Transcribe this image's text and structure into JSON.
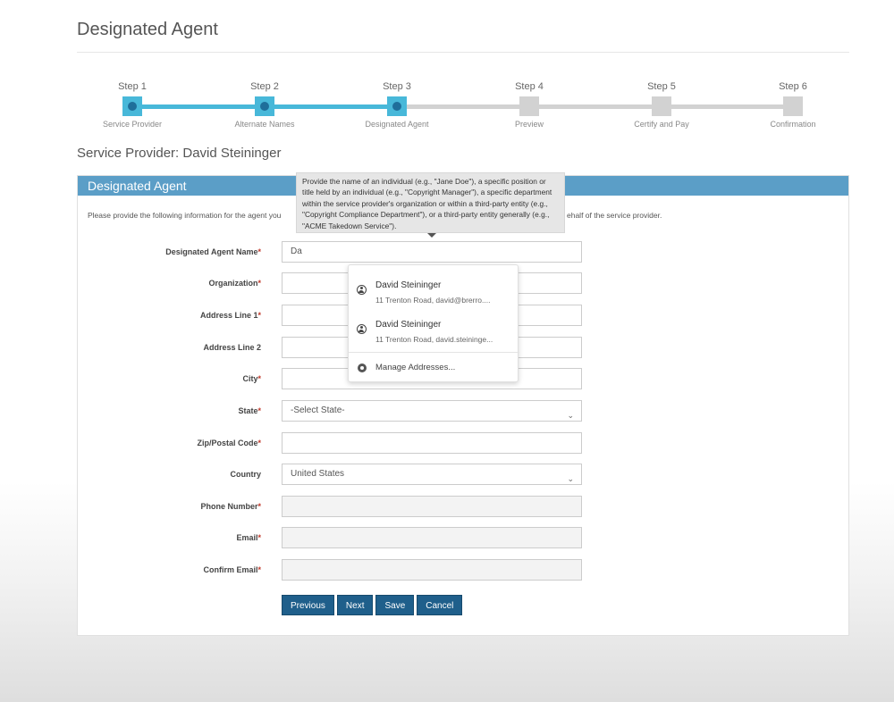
{
  "page": {
    "title": "Designated Agent"
  },
  "stepper": {
    "steps": [
      {
        "top": "Step 1",
        "bottom": "Service Provider",
        "done": true
      },
      {
        "top": "Step 2",
        "bottom": "Alternate Names",
        "done": true
      },
      {
        "top": "Step 3",
        "bottom": "Designated Agent",
        "done": true
      },
      {
        "top": "Step 4",
        "bottom": "Preview",
        "done": false
      },
      {
        "top": "Step 5",
        "bottom": "Certify and Pay",
        "done": false
      },
      {
        "top": "Step 6",
        "bottom": "Confirmation",
        "done": false
      }
    ],
    "active_color": "#48b8d9",
    "inactive_color": "#d2d2d2"
  },
  "service_provider_heading": "Service Provider: David Steininger",
  "panel": {
    "header": "Designated Agent",
    "desc_start": "Please provide the following information for the agent you",
    "desc_end": "ehalf of the service provider."
  },
  "tooltip": {
    "text": "Provide the name of an individual (e.g., \"Jane Doe\"), a specific position or title held by an individual (e.g., \"Copyright Manager\"), a specific department within the service provider's organization or within a third-party entity (e.g., \"Copyright Compliance Department\"), or a third-party entity generally (e.g., \"ACME Takedown Service\")."
  },
  "form": {
    "agent_name": {
      "label": "Designated Agent Name",
      "value": "Da"
    },
    "organization": {
      "label": "Organization",
      "value": ""
    },
    "address1": {
      "label": "Address Line 1",
      "value": ""
    },
    "address2": {
      "label": "Address Line 2",
      "value": ""
    },
    "city": {
      "label": "City",
      "value": ""
    },
    "state": {
      "label": "State",
      "value": "-Select State-"
    },
    "zip": {
      "label": "Zip/Postal Code",
      "value": ""
    },
    "country": {
      "label": "Country",
      "value": "United States"
    },
    "phone": {
      "label": "Phone Number",
      "value": ""
    },
    "email": {
      "label": "Email",
      "value": ""
    },
    "confirm_email": {
      "label": "Confirm Email",
      "value": ""
    },
    "required_mark": "*",
    "chevron": "⌄"
  },
  "buttons": {
    "previous": "Previous",
    "next": "Next",
    "save": "Save",
    "cancel": "Cancel"
  },
  "autofill": {
    "items": [
      {
        "name": "David Steininger",
        "sub": "11 Trenton Road, david@brerro...."
      },
      {
        "name": "David Steininger",
        "sub": "11 Trenton Road, david.steininge..."
      }
    ],
    "manage_label": "Manage Addresses..."
  }
}
